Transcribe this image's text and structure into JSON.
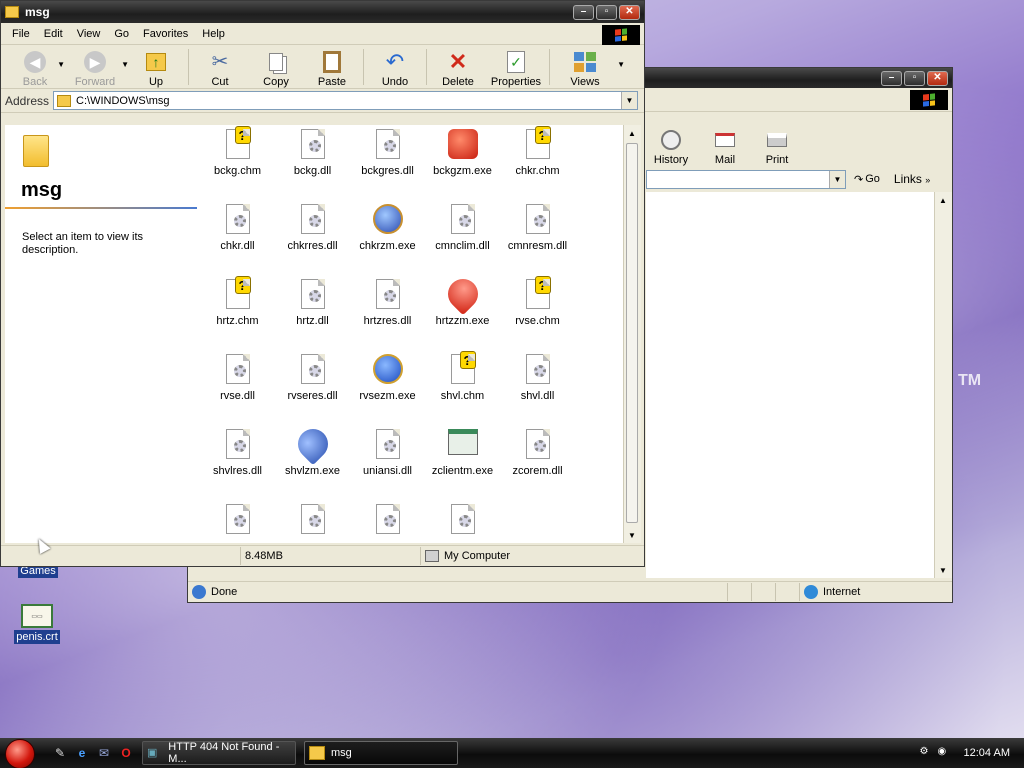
{
  "desktop": {
    "icons": [
      {
        "label": "Games",
        "icon": "games-icon"
      },
      {
        "label": "penis.crt",
        "icon": "certificate-icon"
      }
    ],
    "trademark": "TM"
  },
  "explorer": {
    "title": "msg",
    "menu": [
      "File",
      "Edit",
      "View",
      "Go",
      "Favorites",
      "Help"
    ],
    "toolbar": {
      "back": "Back",
      "forward": "Forward",
      "up": "Up",
      "cut": "Cut",
      "copy": "Copy",
      "paste": "Paste",
      "undo": "Undo",
      "delete": "Delete",
      "properties": "Properties",
      "views": "Views"
    },
    "address_label": "Address",
    "address_value": "C:\\WINDOWS\\msg",
    "panel": {
      "title": "msg",
      "description": "Select an item to view its description."
    },
    "files": [
      {
        "name": "bckg.chm",
        "type": "chm"
      },
      {
        "name": "bckg.dll",
        "type": "dll"
      },
      {
        "name": "bckgres.dll",
        "type": "dll"
      },
      {
        "name": "bckgzm.exe",
        "type": "exe-red"
      },
      {
        "name": "chkr.chm",
        "type": "chm"
      },
      {
        "name": "chkr.dll",
        "type": "dll"
      },
      {
        "name": "chkrres.dll",
        "type": "dll"
      },
      {
        "name": "chkrzm.exe",
        "type": "exe-blue"
      },
      {
        "name": "cmnclim.dll",
        "type": "dll"
      },
      {
        "name": "cmnresm.dll",
        "type": "dll"
      },
      {
        "name": "hrtz.chm",
        "type": "chm"
      },
      {
        "name": "hrtz.dll",
        "type": "dll"
      },
      {
        "name": "hrtzres.dll",
        "type": "dll"
      },
      {
        "name": "hrtzzm.exe",
        "type": "exe-heart"
      },
      {
        "name": "rvse.chm",
        "type": "chm"
      },
      {
        "name": "rvse.dll",
        "type": "dll"
      },
      {
        "name": "rvseres.dll",
        "type": "dll"
      },
      {
        "name": "rvsezm.exe",
        "type": "exe-globe"
      },
      {
        "name": "shvl.chm",
        "type": "chm"
      },
      {
        "name": "shvl.dll",
        "type": "dll"
      },
      {
        "name": "shvlres.dll",
        "type": "dll"
      },
      {
        "name": "shvlzm.exe",
        "type": "exe-shovel"
      },
      {
        "name": "uniansi.dll",
        "type": "dll"
      },
      {
        "name": "zclientm.exe",
        "type": "exe-window"
      },
      {
        "name": "zcorem.dll",
        "type": "dll"
      },
      {
        "name": "",
        "type": "dll"
      },
      {
        "name": "",
        "type": "dll"
      },
      {
        "name": "",
        "type": "dll"
      },
      {
        "name": "",
        "type": "dll"
      }
    ],
    "status": {
      "size": "8.48MB",
      "location": "My Computer"
    }
  },
  "browser": {
    "toolbar": {
      "history": "History",
      "mail": "Mail",
      "print": "Print"
    },
    "go": "Go",
    "links": "Links",
    "status": {
      "text": "Done",
      "zone": "Internet"
    }
  },
  "taskbar": {
    "tasks": [
      {
        "label": "HTTP 404 Not Found - M...",
        "active": false
      },
      {
        "label": "msg",
        "active": true
      }
    ],
    "clock": "12:04 AM"
  }
}
